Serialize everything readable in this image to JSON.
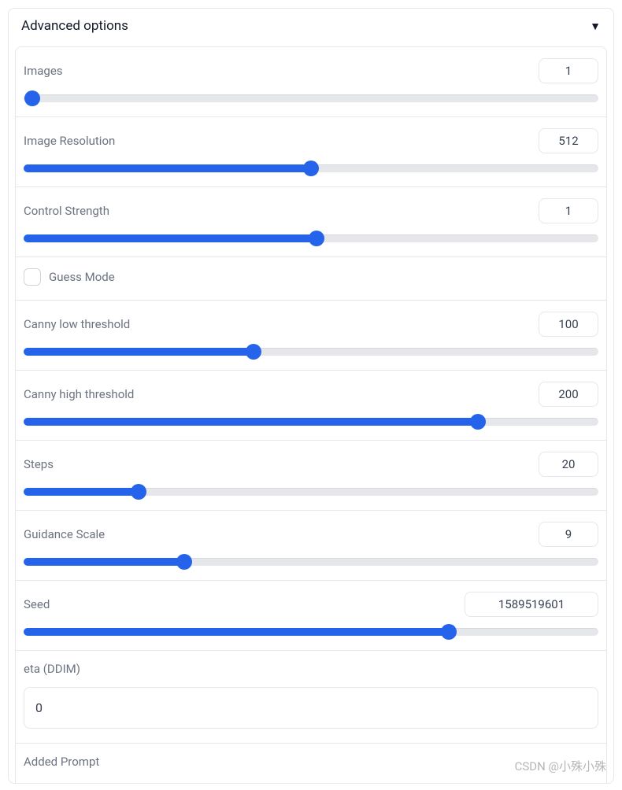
{
  "panel": {
    "title": "Advanced options"
  },
  "sliders": {
    "images": {
      "label": "Images",
      "value": "1",
      "fill_pct": 0
    },
    "image_resolution": {
      "label": "Image Resolution",
      "value": "512",
      "fill_pct": 50
    },
    "control_strength": {
      "label": "Control Strength",
      "value": "1",
      "fill_pct": 51
    },
    "canny_low": {
      "label": "Canny low threshold",
      "value": "100",
      "fill_pct": 40
    },
    "canny_high": {
      "label": "Canny high threshold",
      "value": "200",
      "fill_pct": 79
    },
    "steps": {
      "label": "Steps",
      "value": "20",
      "fill_pct": 20
    },
    "guidance": {
      "label": "Guidance Scale",
      "value": "9",
      "fill_pct": 28
    },
    "seed": {
      "label": "Seed",
      "value": "1589519601",
      "fill_pct": 74
    }
  },
  "checkbox": {
    "guess_mode": {
      "label": "Guess Mode",
      "checked": false
    }
  },
  "inputs": {
    "eta": {
      "label": "eta (DDIM)",
      "value": "0"
    },
    "added_prompt": {
      "label": "Added Prompt"
    }
  },
  "watermark": "CSDN @小殊小殊"
}
